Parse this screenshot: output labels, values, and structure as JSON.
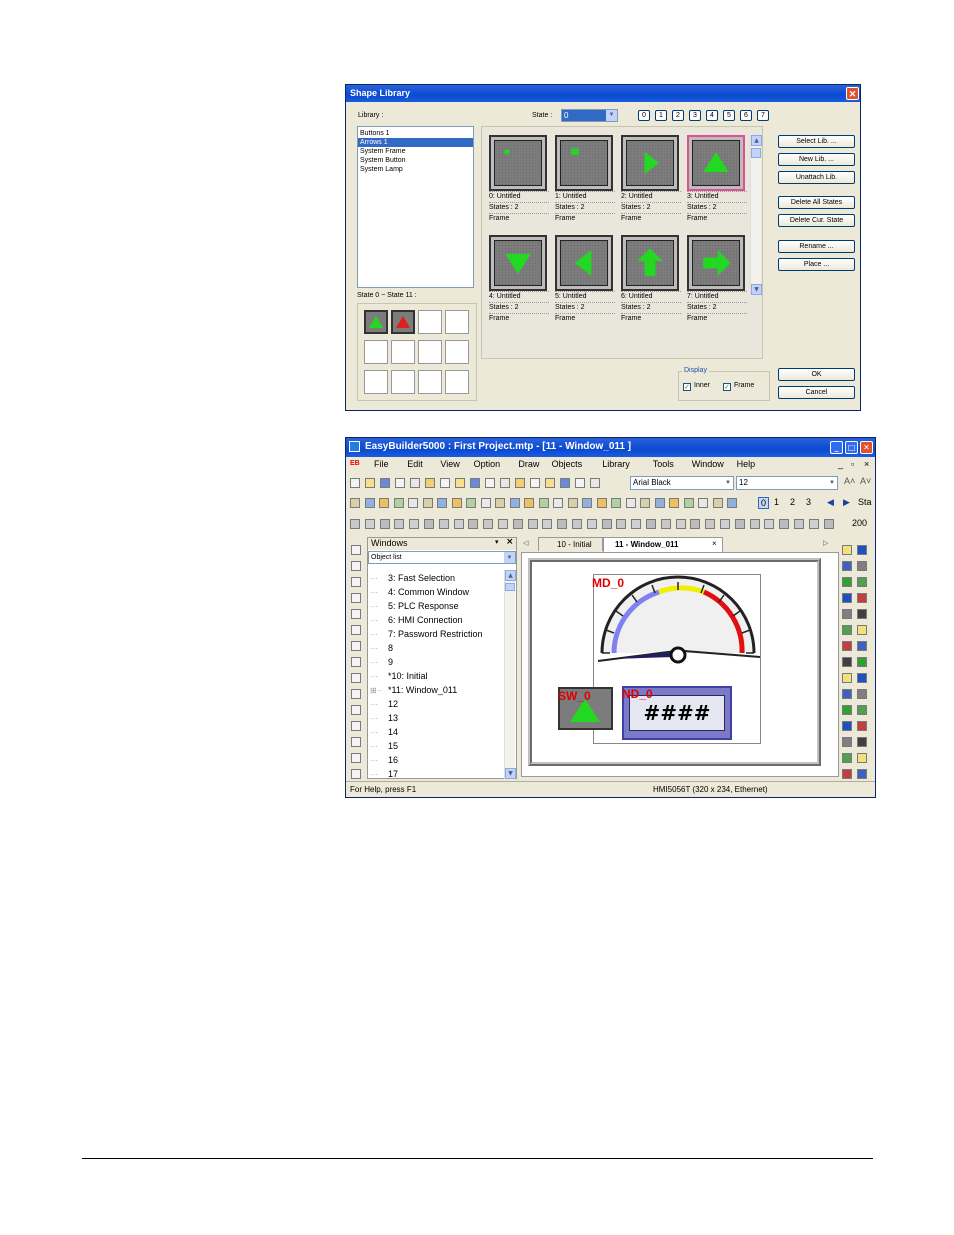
{
  "dialog": {
    "title": "Shape Library",
    "library_label": "Library :",
    "state_label": "State :",
    "state_value": "0",
    "state_buttons": [
      "0",
      "1",
      "2",
      "3",
      "4",
      "5",
      "6",
      "7"
    ],
    "libraries": [
      "Buttons 1",
      "Arrows 1",
      "System Frame",
      "System Button",
      "System Lamp"
    ],
    "selected_library": "Arrows 1",
    "state_range_label": "State 0 ~ State 11 :",
    "shapes": [
      {
        "name": "0: Untitled",
        "states": "States : 2",
        "kind": "Frame",
        "icon": "dot-icon"
      },
      {
        "name": "1: Untitled",
        "states": "States : 2",
        "kind": "Frame",
        "icon": "square-icon"
      },
      {
        "name": "2: Untitled",
        "states": "States : 2",
        "kind": "Frame",
        "icon": "arrow-right-triangle-icon"
      },
      {
        "name": "3: Untitled",
        "states": "States : 2",
        "kind": "Frame",
        "icon": "arrow-up-triangle-icon"
      },
      {
        "name": "4: Untitled",
        "states": "States : 2",
        "kind": "Frame",
        "icon": "arrow-down-triangle-icon"
      },
      {
        "name": "5: Untitled",
        "states": "States : 2",
        "kind": "Frame",
        "icon": "arrow-left-triangle-icon"
      },
      {
        "name": "6: Untitled",
        "states": "States : 2",
        "kind": "Frame",
        "icon": "arrow-up-block-icon"
      },
      {
        "name": "7: Untitled",
        "states": "States : 2",
        "kind": "Frame",
        "icon": "arrow-right-block-icon"
      }
    ],
    "buttons": [
      "Select Lib. ...",
      "New Lib. ...",
      "Unattach Lib.",
      "Delete All States",
      "Delete Cur. State",
      "Rename ...",
      "Place ..."
    ],
    "display_label": "Display",
    "inner_label": "Inner",
    "frame_label": "Frame",
    "inner_checked": true,
    "frame_checked": true,
    "ok_label": "OK",
    "cancel_label": "Cancel"
  },
  "eb": {
    "title": "EasyBuilder5000 : First Project.mtp - [11 - Window_011 ]",
    "menu_logo": "EB",
    "menu": [
      "File",
      "Edit",
      "View",
      "Option",
      "Draw",
      "Objects",
      "Library",
      "Tools",
      "Window",
      "Help"
    ],
    "font_name": "Arial Black",
    "font_size": "12",
    "toolbar_numbers": [
      "0",
      "1",
      "2",
      "3"
    ],
    "toolbar_trailing": "Sta",
    "zoom": "200",
    "windows_panel_title": "Windows",
    "object_list_label": "Object list",
    "tree": [
      "3: Fast Selection",
      "4: Common Window",
      "5: PLC Response",
      "6: HMI Connection",
      "7: Password Restriction",
      "8",
      "9",
      "*10: Initial",
      "*11: Window_011",
      "12",
      "13",
      "14",
      "15",
      "16",
      "17"
    ],
    "tabs": [
      "10 - Initial",
      "11 - Window_011"
    ],
    "canvas": {
      "md_label": "MD_0",
      "sw_label": "SW_0",
      "nd_label": "ND_0",
      "numeric_display": "####"
    },
    "status_left": "For Help, press F1",
    "status_right": "HMI5056T (320 x 234, Ethernet)"
  }
}
